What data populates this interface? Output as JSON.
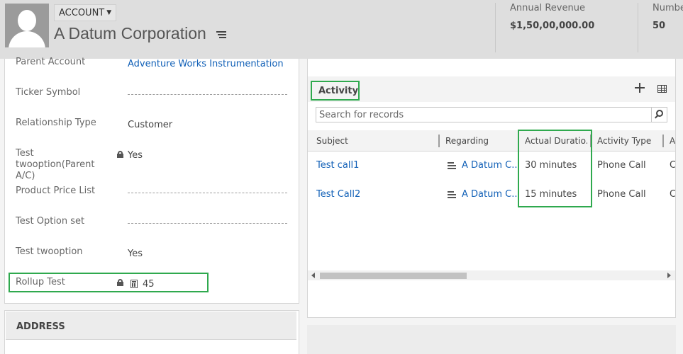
{
  "header": {
    "entity_type": "ACCOUNT",
    "record_name": "A Datum Corporation",
    "fields": [
      {
        "label": "Annual Revenue",
        "value": "$1,50,00,000.00"
      },
      {
        "label": "Numbe",
        "value": "50"
      }
    ]
  },
  "form": {
    "fields": [
      {
        "label": "Parent Account",
        "value": "Adventure Works Instrumentation"
      },
      {
        "label": "Ticker Symbol",
        "value": ""
      },
      {
        "label": "Relationship Type",
        "value": "Customer"
      },
      {
        "label": "Test twooption(Parent A/C)",
        "value": "Yes"
      },
      {
        "label": "Product Price List",
        "value": ""
      },
      {
        "label": "Test Option set",
        "value": ""
      },
      {
        "label": "Test twooption",
        "value": "Yes"
      },
      {
        "label": "Rollup Test",
        "value": "45"
      }
    ],
    "address_title": "ADDRESS"
  },
  "activity": {
    "title": "Activity",
    "search_placeholder": "Search for records",
    "columns": [
      "Subject",
      "Regarding",
      "Actual Duratio...",
      "Activity Type",
      "A"
    ],
    "rows": [
      {
        "subject": "Test call1",
        "regarding": "A Datum C...",
        "duration": "30 minutes",
        "type": "Phone Call",
        "extra": "C"
      },
      {
        "subject": "Test Call2",
        "regarding": "A Datum C...",
        "duration": "15 minutes",
        "type": "Phone Call",
        "extra": "C"
      }
    ]
  },
  "colors": {
    "highlight": "#2fa94e",
    "link": "#1160b7",
    "header_bg": "#dedede"
  },
  "icons": [
    "avatar-icon",
    "chevron-down-icon",
    "list-menu-icon",
    "lock-icon",
    "calculator-icon",
    "plus-icon",
    "grid-view-icon",
    "search-icon",
    "document-icon"
  ]
}
